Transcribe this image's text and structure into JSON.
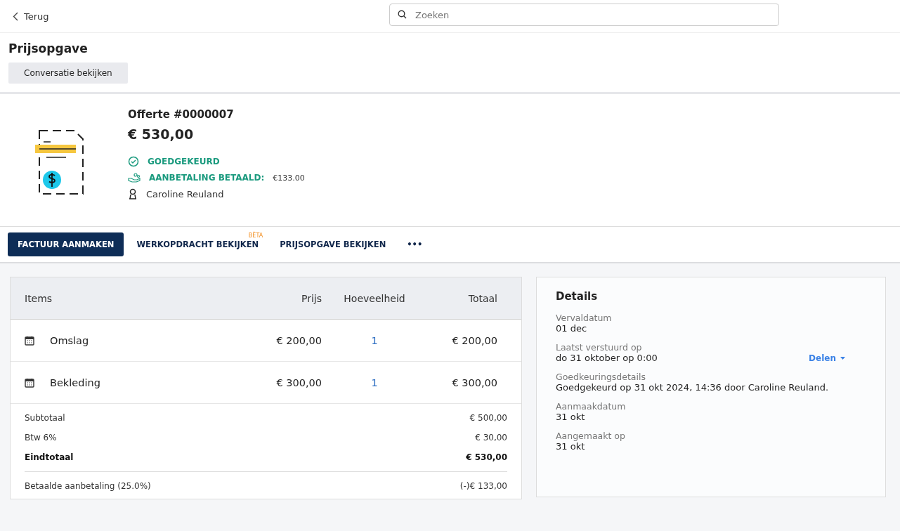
{
  "topbar": {
    "back": "Terug",
    "search": {
      "placeholder": "Zoeken"
    }
  },
  "header": {
    "title": "Prijsopgave",
    "button": "Conversatie bekijken"
  },
  "quote": {
    "number": "Offerte #0000007",
    "amount": "€ 530,00",
    "statuses": [
      {
        "kind": "approved",
        "label": "GOEDGEKEURD"
      },
      {
        "kind": "deposit",
        "label": "AANBETALING BETAALD:",
        "value": "€133.00"
      },
      {
        "kind": "person",
        "value": "Caroline Reuland"
      }
    ]
  },
  "actions": [
    {
      "kind": "primary",
      "label": "FACTUUR AANMAKEN"
    },
    {
      "kind": "link",
      "label": "WERKOPDRACHT BEKIJKEN",
      "badge": "BÈTA"
    },
    {
      "kind": "link",
      "label": "PRIJSOPGAVE BEKIJKEN"
    },
    {
      "kind": "more",
      "label": "•••"
    }
  ],
  "items_table": {
    "columns": [
      "Items",
      "Prijs",
      "Hoeveelheid",
      "Totaal"
    ],
    "rows": [
      {
        "name": "Omslag",
        "price": "€ 200,00",
        "quantity": "1",
        "total": "€ 200,00"
      },
      {
        "name": "Bekleding",
        "price": "€ 300,00",
        "quantity": "1",
        "total": "€ 300,00"
      }
    ],
    "summary": [
      {
        "label": "Subtotaal",
        "value": "€ 500,00",
        "bold": false,
        "divider_before": false
      },
      {
        "label": "Btw 6%",
        "value": "€ 30,00",
        "bold": false,
        "divider_before": false
      },
      {
        "label": "Eindtotaal",
        "value": "€ 530,00",
        "bold": true,
        "divider_before": false
      },
      {
        "label": "Betaalde aanbetaling (25.0%)",
        "value": "(-)€ 133,00",
        "bold": false,
        "divider_before": true
      }
    ]
  },
  "details": {
    "title": "Details",
    "share": "Delen",
    "fields": [
      {
        "label": "Vervaldatum",
        "value": "01 dec"
      },
      {
        "label": "Laatst verstuurd op",
        "value": "do 31 oktober op 0:00",
        "kind": "share"
      },
      {
        "label": "Goedkeuringsdetails",
        "value": "Goedgekeurd op 31 okt 2024, 14:36 door Caroline Reuland."
      },
      {
        "label": "Aanmaakdatum",
        "value": "31 okt"
      },
      {
        "label": "Aangemaakt op",
        "value": "31 okt"
      }
    ]
  }
}
